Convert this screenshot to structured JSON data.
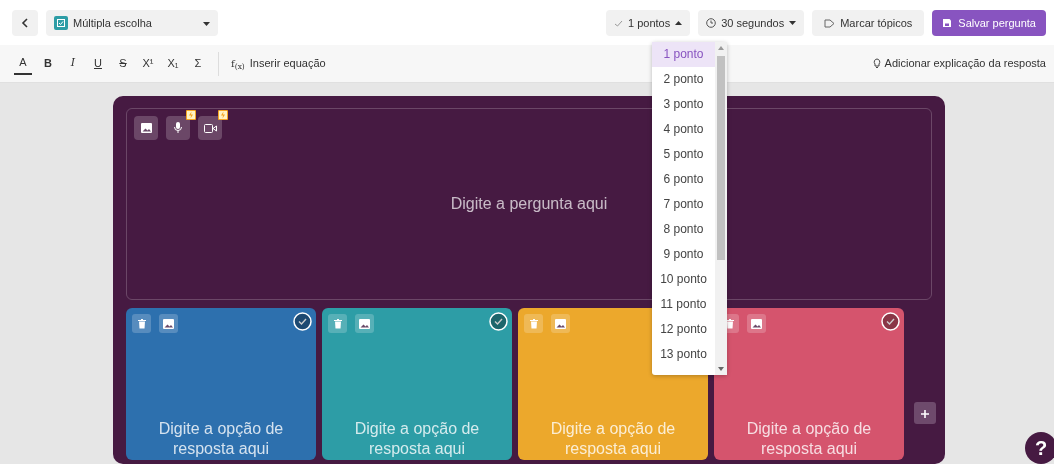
{
  "header": {
    "question_type": "Múltipla escolha",
    "points": "1 pontos",
    "time": "30 segundos",
    "tags_button": "Marcar tópicos",
    "save_button": "Salvar pergunta"
  },
  "format_toolbar": {
    "buttons": [
      {
        "label": "A",
        "selected": true
      },
      {
        "label": "B",
        "selected": false
      },
      {
        "label": "I",
        "selected": false
      },
      {
        "label": "U",
        "selected": false
      },
      {
        "label": "S",
        "selected": false
      },
      {
        "label": "X¹",
        "selected": false
      },
      {
        "label": "X₁",
        "selected": false
      },
      {
        "label": "Σ",
        "selected": false
      }
    ],
    "equation_icon": "f$_{(x)}$",
    "equation": "Inserir equação",
    "explanation": "Adicionar explicação da resposta"
  },
  "question": {
    "placeholder": "Digite a pergunta aqui",
    "media": [
      {
        "kind": "image",
        "premium": false
      },
      {
        "kind": "audio",
        "premium": true
      },
      {
        "kind": "video",
        "premium": true
      }
    ]
  },
  "options": [
    {
      "placeholder": "Digite a opção de resposta aqui",
      "color": "#2d70ae"
    },
    {
      "placeholder": "Digite a opção de resposta aqui",
      "color": "#2d9da6"
    },
    {
      "placeholder": "Digite a opção de resposta aqui",
      "color": "#eca82c"
    },
    {
      "placeholder": "Digite a opção de resposta aqui",
      "color": "#d5546d"
    }
  ],
  "points_dropdown": {
    "items": [
      {
        "label": "1 ponto",
        "selected": true
      },
      {
        "label": "2 ponto",
        "selected": false
      },
      {
        "label": "3 ponto",
        "selected": false
      },
      {
        "label": "4 ponto",
        "selected": false
      },
      {
        "label": "5 ponto",
        "selected": false
      },
      {
        "label": "6 ponto",
        "selected": false
      },
      {
        "label": "7 ponto",
        "selected": false
      },
      {
        "label": "8 ponto",
        "selected": false
      },
      {
        "label": "9 ponto",
        "selected": false
      },
      {
        "label": "10 ponto",
        "selected": false
      },
      {
        "label": "11 ponto",
        "selected": false
      },
      {
        "label": "12 ponto",
        "selected": false
      },
      {
        "label": "13 ponto",
        "selected": false
      }
    ]
  },
  "help_button": "?"
}
